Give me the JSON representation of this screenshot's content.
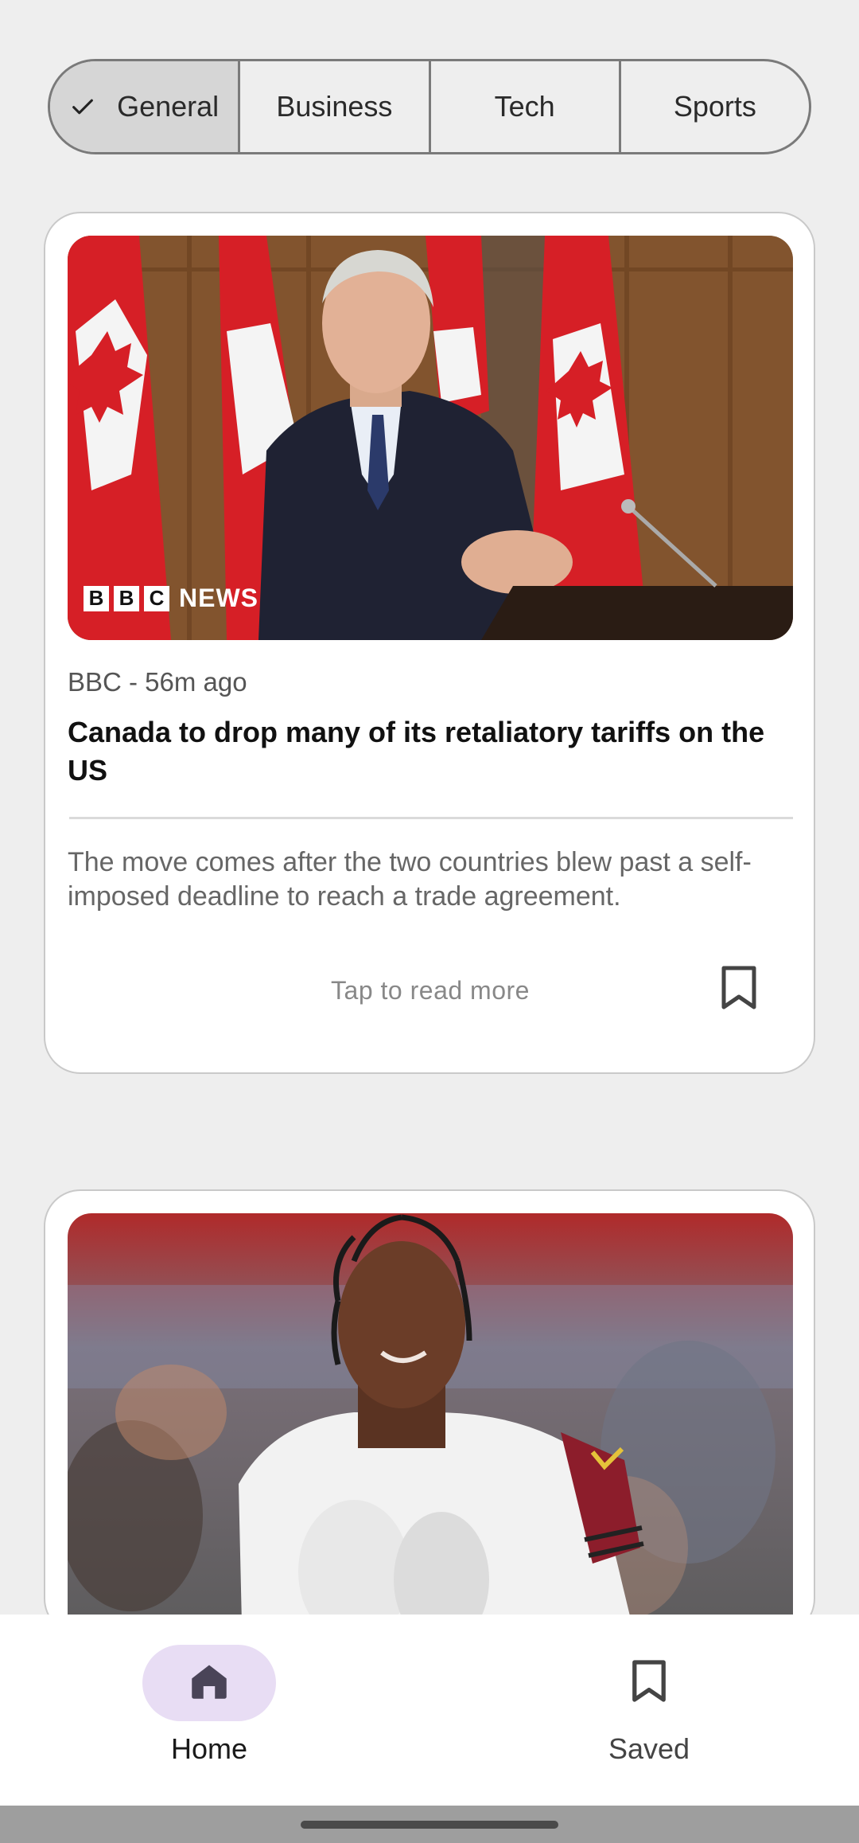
{
  "tabs": [
    {
      "label": "General",
      "selected": true
    },
    {
      "label": "Business",
      "selected": false
    },
    {
      "label": "Tech",
      "selected": false
    },
    {
      "label": "Sports",
      "selected": false
    }
  ],
  "articles": [
    {
      "image_icon": "photo-podium-speaker",
      "image_logo": {
        "letters": [
          "B",
          "B",
          "C"
        ],
        "word": "NEWS"
      },
      "meta": "BBC - 56m ago",
      "headline": "Canada to drop many of its retaliatory tariffs on the US",
      "summary": "The move comes after the two countries blew past a self-imposed deadline to reach a trade agreement.",
      "read_more": "Tap to read more",
      "bookmark_icon": "bookmark-outline-icon"
    },
    {
      "image_icon": "photo-football-player"
    }
  ],
  "nav": {
    "home_label": "Home",
    "home_icon": "home-icon",
    "saved_label": "Saved",
    "saved_icon": "bookmark-icon"
  },
  "colors": {
    "background": "#eeeeee",
    "selected_tab": "#d6d6d6",
    "nav_active_pill": "#e8ddf4"
  }
}
